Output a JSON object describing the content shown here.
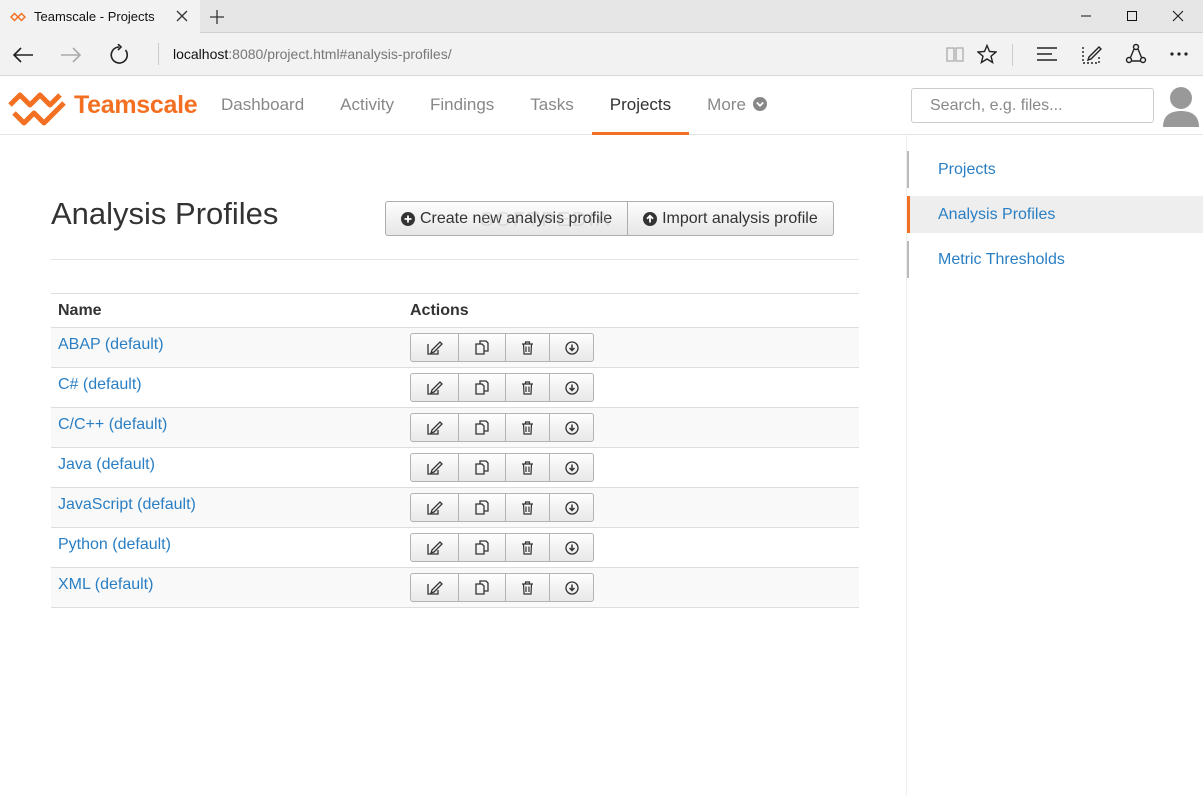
{
  "browser": {
    "tab_title": "Teamscale - Projects",
    "url_host": "localhost",
    "url_rest": ":8080/project.html#analysis-profiles/"
  },
  "header": {
    "logo_text": "Teamscale",
    "nav": [
      "Dashboard",
      "Activity",
      "Findings",
      "Tasks",
      "Projects",
      "More"
    ],
    "active_nav": "Projects",
    "search_placeholder": "Search, e.g. files..."
  },
  "main": {
    "title": "Analysis Profiles",
    "create_button": "Create new analysis profile",
    "import_button": "Import analysis profile",
    "table": {
      "columns": [
        "Name",
        "Actions"
      ],
      "rows": [
        "ABAP (default)",
        "C# (default)",
        "C/C++ (default)",
        "Java (default)",
        "JavaScript (default)",
        "Python (default)",
        "XML (default)"
      ]
    }
  },
  "sidebar": {
    "items": [
      "Projects",
      "Analysis Profiles",
      "Metric Thresholds"
    ],
    "active": "Analysis Profiles"
  },
  "colors": {
    "accent": "#f36f21",
    "link": "#2a7fc4"
  },
  "icons": {
    "row_actions": [
      "edit-icon",
      "copy-icon",
      "trash-icon",
      "download-icon"
    ]
  }
}
